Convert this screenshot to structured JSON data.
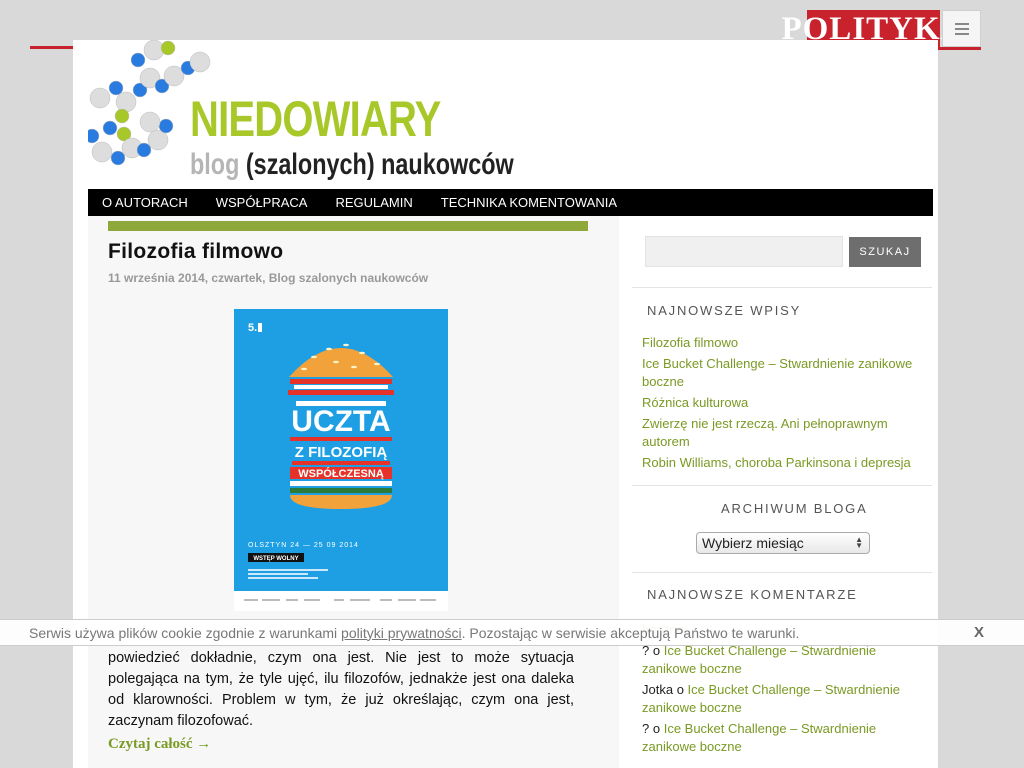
{
  "top": {
    "brand": "POLITYKA",
    "menu_icon": "hamburger-icon"
  },
  "header": {
    "title": "NIEDOWIARY",
    "subtitle_grey": "blog",
    "subtitle_dark": "(szalonych) naukowców",
    "logo_icon": "molecule-logo-icon"
  },
  "nav": {
    "items": [
      "O AUTORACH",
      "WSPÓŁPRACA",
      "REGULAMIN",
      "TECHNIKA KOMENTOWANIA"
    ]
  },
  "post": {
    "title": "Filozofia filmowo",
    "meta": "11 września 2014, czwartek, Blog szalonych naukowców",
    "poster": {
      "badge": "5.",
      "line1": "UCZTA",
      "line2": "Z FILOZOFIĄ",
      "line3": "WSPÓŁCZESNĄ",
      "dates": "OLSZTYN  24 — 25 09 2014",
      "entry": "WSTĘP WOLNY"
    },
    "text": "powiedzieć dokładnie, czym ona jest. Nie jest to może sytuacja polegająca na tym, że tyle ujęć, ilu filozofów, jednakże jest ona daleka od klarowności. Problem w tym, że już określając, czym ona jest, zaczynam filozofować.",
    "read_more": "Czytaj całość →"
  },
  "sidebar": {
    "search_placeholder": "",
    "search_button": "SZUKAJ",
    "recent_title": "NAJNOWSZE WPISY",
    "recent_posts": [
      "Filozofia filmowo",
      "Ice Bucket Challenge – Stwardnienie zanikowe boczne",
      "Różnica kulturowa",
      "Zwierzę nie jest rzeczą. Ani pełnoprawnym autorem",
      "Robin Williams, choroba Parkinsona i depresja"
    ],
    "archive_title": "ARCHIWUM BLOGA",
    "archive_select": "Wybierz miesiąc",
    "comments_title": "NAJNOWSZE KOMENTARZE",
    "comments": [
      {
        "author": "",
        "sep": "",
        "link": "boczne"
      },
      {
        "author": "?",
        "sep": " o ",
        "link": "Ice Bucket Challenge – Stwardnienie zanikowe boczne"
      },
      {
        "author": "Jotka",
        "sep": " o ",
        "link": "Ice Bucket Challenge – Stwardnienie zanikowe boczne"
      },
      {
        "author": "?",
        "sep": " o ",
        "link": "Ice Bucket Challenge – Stwardnienie zanikowe boczne"
      }
    ]
  },
  "cookie": {
    "text_before": "Serwis używa plików cookie zgodnie z warunkami ",
    "link": "polityki prywatności",
    "text_after": ". Pozostając w serwisie akceptują Państwo te warunki.",
    "close": "X"
  }
}
